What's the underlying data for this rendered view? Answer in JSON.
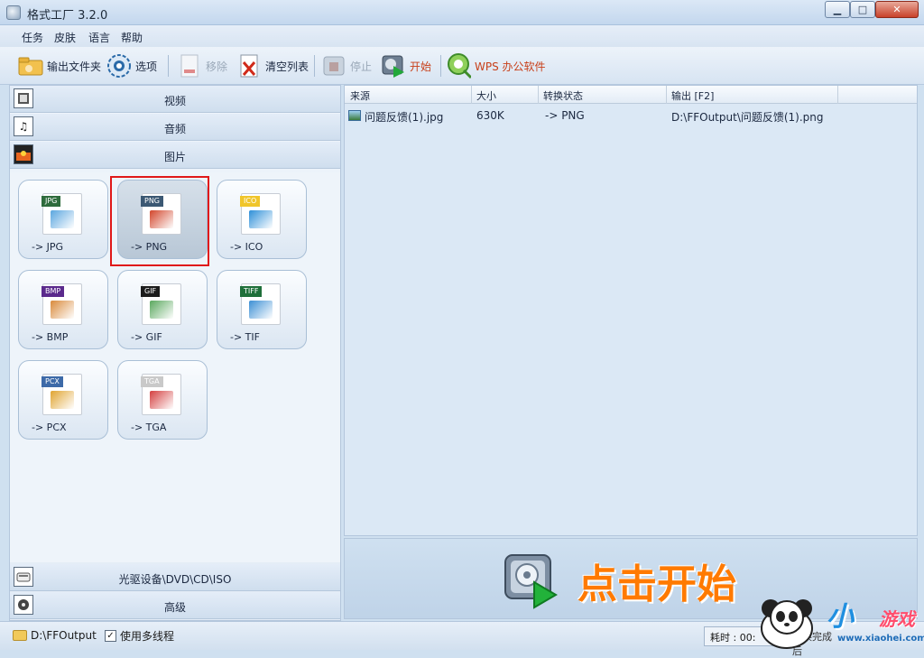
{
  "window": {
    "title": "格式工厂 3.2.0",
    "controls": {
      "minimize": "▁",
      "maximize": "□",
      "close": "✕"
    }
  },
  "menu": [
    "任务",
    "皮肤",
    "语言",
    "帮助"
  ],
  "toolbar": {
    "output_folder": "输出文件夹",
    "options": "选项",
    "remove": "移除",
    "clear_list": "清空列表",
    "stop": "停止",
    "start": "开始",
    "wps": "WPS 办公软件"
  },
  "categories": {
    "video": "视频",
    "audio": "音频",
    "picture": "图片",
    "rom": "光驱设备\\DVD\\CD\\ISO",
    "advanced": "高级"
  },
  "tiles": [
    {
      "tag": "JPG",
      "label": "-> JPG",
      "tag_color": "#2e6b3c",
      "pic_color": "#5aa6df"
    },
    {
      "tag": "PNG",
      "label": "-> PNG",
      "tag_color": "#3b5873",
      "pic_color": "#d2462b",
      "selected": true
    },
    {
      "tag": "ICO",
      "label": "-> ICO",
      "tag_color": "#f0c52a",
      "pic_color": "#2d8fd8"
    },
    {
      "tag": "BMP",
      "label": "-> BMP",
      "tag_color": "#5b2a8c",
      "pic_color": "#d98a3b"
    },
    {
      "tag": "GIF",
      "label": "-> GIF",
      "tag_color": "#1c1c1c",
      "pic_color": "#5aa85e"
    },
    {
      "tag": "TIFF",
      "label": "-> TIF",
      "tag_color": "#1f6f3a",
      "pic_color": "#3c8fd4"
    },
    {
      "tag": "PCX",
      "label": "-> PCX",
      "tag_color": "#3d6aa8",
      "pic_color": "#e0a431"
    },
    {
      "tag": "TGA",
      "label": "-> TGA",
      "tag_color": "#c9c9c9",
      "pic_color": "#d44040"
    }
  ],
  "file_list": {
    "columns": [
      "来源",
      "大小",
      "转换状态",
      "输出 [F2]"
    ],
    "rows": [
      {
        "source": "问题反馈(1).jpg",
        "size": "630K",
        "status": "-> PNG",
        "output": "D:\\FFOutput\\问题反馈(1).png"
      }
    ]
  },
  "banner": {
    "text": "点击开始"
  },
  "status": {
    "output_path": "D:\\FFOutput",
    "multithread_label": "使用多线程",
    "multithread_checked": "✓",
    "elapsed_label": "耗时 : 00:",
    "after_label": "转换完成后"
  },
  "watermark": {
    "brand": "小",
    "brand2": "游戏",
    "url": "www.xiaohei.com"
  }
}
